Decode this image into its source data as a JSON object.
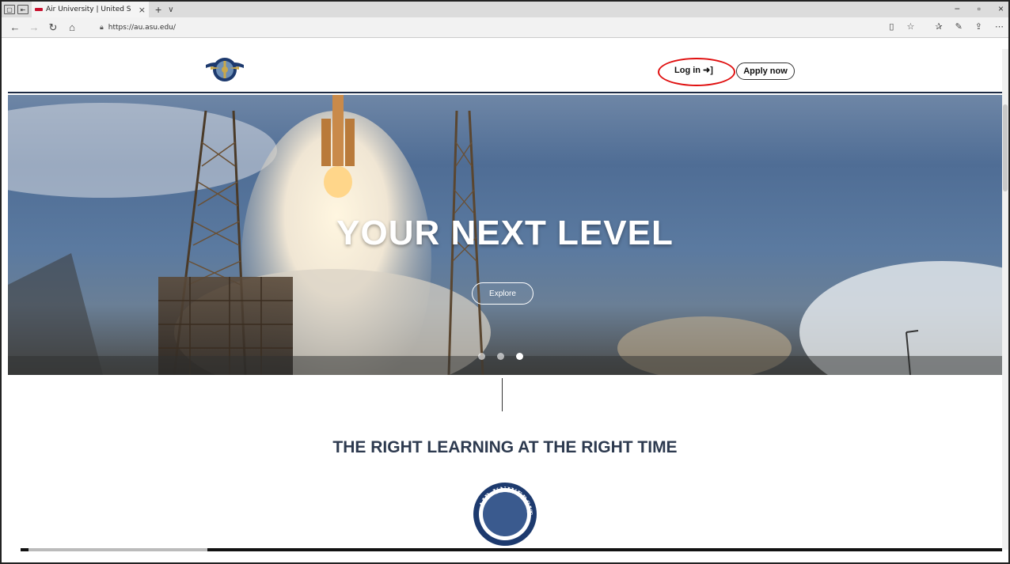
{
  "browser": {
    "tab_title": "Air University | United S",
    "tab_close": "×",
    "new_tab": "+",
    "tab_menu": "∨",
    "url": "https://au.asu.edu/",
    "window_controls": [
      "−",
      "▫",
      "×"
    ],
    "toolbar_icons": [
      "reading-view-icon",
      "favorite-star-icon",
      "favorites-icon",
      "pen-icon",
      "share-icon",
      "more-icon"
    ]
  },
  "header": {
    "login_label": "Log in",
    "apply_label": "Apply now",
    "annotation_color": "#e01010"
  },
  "hero": {
    "title": "YOUR NEXT LEVEL",
    "cta_label": "Explore",
    "carousel": {
      "count": 3,
      "active_index": 2
    }
  },
  "section": {
    "tagline": "THE RIGHT LEARNING AT THE RIGHT TIME",
    "seal_text": "AIR UNIVERSITY"
  },
  "colors": {
    "brand_navy": "#1d2a44",
    "tagline": "#2d3a4f"
  }
}
